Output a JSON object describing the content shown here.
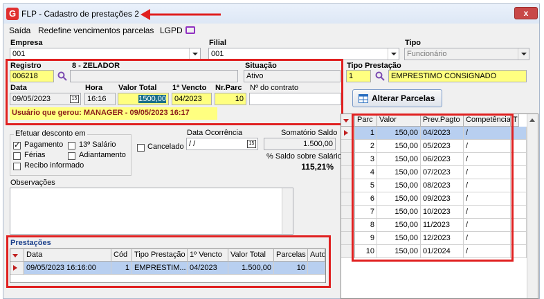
{
  "window": {
    "title": "FLP - Cadastro de prestações 2",
    "app_icon": "G",
    "close": "x"
  },
  "menu": [
    "Saída",
    "Redefine vencimentos parcelas",
    "LGPD"
  ],
  "empresa": {
    "label": "Empresa",
    "value": "001"
  },
  "filial": {
    "label": "Filial",
    "value": "001"
  },
  "tipo": {
    "label": "Tipo",
    "value": "Funcionário"
  },
  "registro": {
    "label": "Registro",
    "value": "006218",
    "name": "8 - ZELADOR",
    "extra": ""
  },
  "situacao": {
    "label": "Situação",
    "value": "Ativo"
  },
  "tipo_prestacao": {
    "label": "Tipo Prestação",
    "code": "1",
    "desc": "EMPRESTIMO CONSIGNADO"
  },
  "data": {
    "label": "Data",
    "value": "09/05/2023"
  },
  "hora": {
    "label": "Hora",
    "value": "16:16"
  },
  "valor_total": {
    "label": "Valor Total",
    "value": "1500,00"
  },
  "primeiro_vencto": {
    "label": "1ª Vencto",
    "value": "04/2023"
  },
  "nr_parc": {
    "label": "Nr.Parc",
    "value": "10"
  },
  "nr_contrato": {
    "label": "Nº do contrato",
    "value": ""
  },
  "usuario": "Usuário que gerou: MANAGER - 09/05/2023 16:17",
  "alterar_parcelas": "Alterar Parcelas",
  "desconto": {
    "title": "Efetuar desconto em",
    "pagamento": "Pagamento",
    "decimo": "13º Salário",
    "ferias": "Férias",
    "adiantamento": "Adiantamento",
    "recibo": "Recibo informado"
  },
  "data_ocorrencia": {
    "label": "Data Ocorrência",
    "value": "/ /"
  },
  "cancelado": "Cancelado",
  "somatorio": {
    "label": "Somatório Saldo",
    "value": "1.500,00"
  },
  "saldo_pct": {
    "label": "% Saldo sobre Salário",
    "value": "115,21%"
  },
  "observacoes": {
    "label": "Observações"
  },
  "prestacoes": {
    "title": "Prestações",
    "columns": [
      "Data",
      "Cód",
      "Tipo Prestação",
      "1º Vencto",
      "Valor Total",
      "Parcelas",
      "Auto d"
    ],
    "rows": [
      [
        "09/05/2023 16:16:00",
        "1",
        "EMPRESTIM...",
        "04/2023",
        "1.500,00",
        "10",
        ""
      ]
    ]
  },
  "parcelas": {
    "columns": [
      "Parc",
      "Valor",
      "Prev.Pagto",
      "Competência",
      "T"
    ],
    "rows": [
      [
        "1",
        "150,00",
        "04/2023",
        "/"
      ],
      [
        "2",
        "150,00",
        "05/2023",
        "/"
      ],
      [
        "3",
        "150,00",
        "06/2023",
        "/"
      ],
      [
        "4",
        "150,00",
        "07/2023",
        "/"
      ],
      [
        "5",
        "150,00",
        "08/2023",
        "/"
      ],
      [
        "6",
        "150,00",
        "09/2023",
        "/"
      ],
      [
        "7",
        "150,00",
        "10/2023",
        "/"
      ],
      [
        "8",
        "150,00",
        "11/2023",
        "/"
      ],
      [
        "9",
        "150,00",
        "12/2023",
        "/"
      ],
      [
        "10",
        "150,00",
        "01/2024",
        "/"
      ]
    ]
  },
  "colors": {
    "highlight_red": "#e02020",
    "yellow_field": "#ffff80",
    "selection": "#b8cff0"
  }
}
